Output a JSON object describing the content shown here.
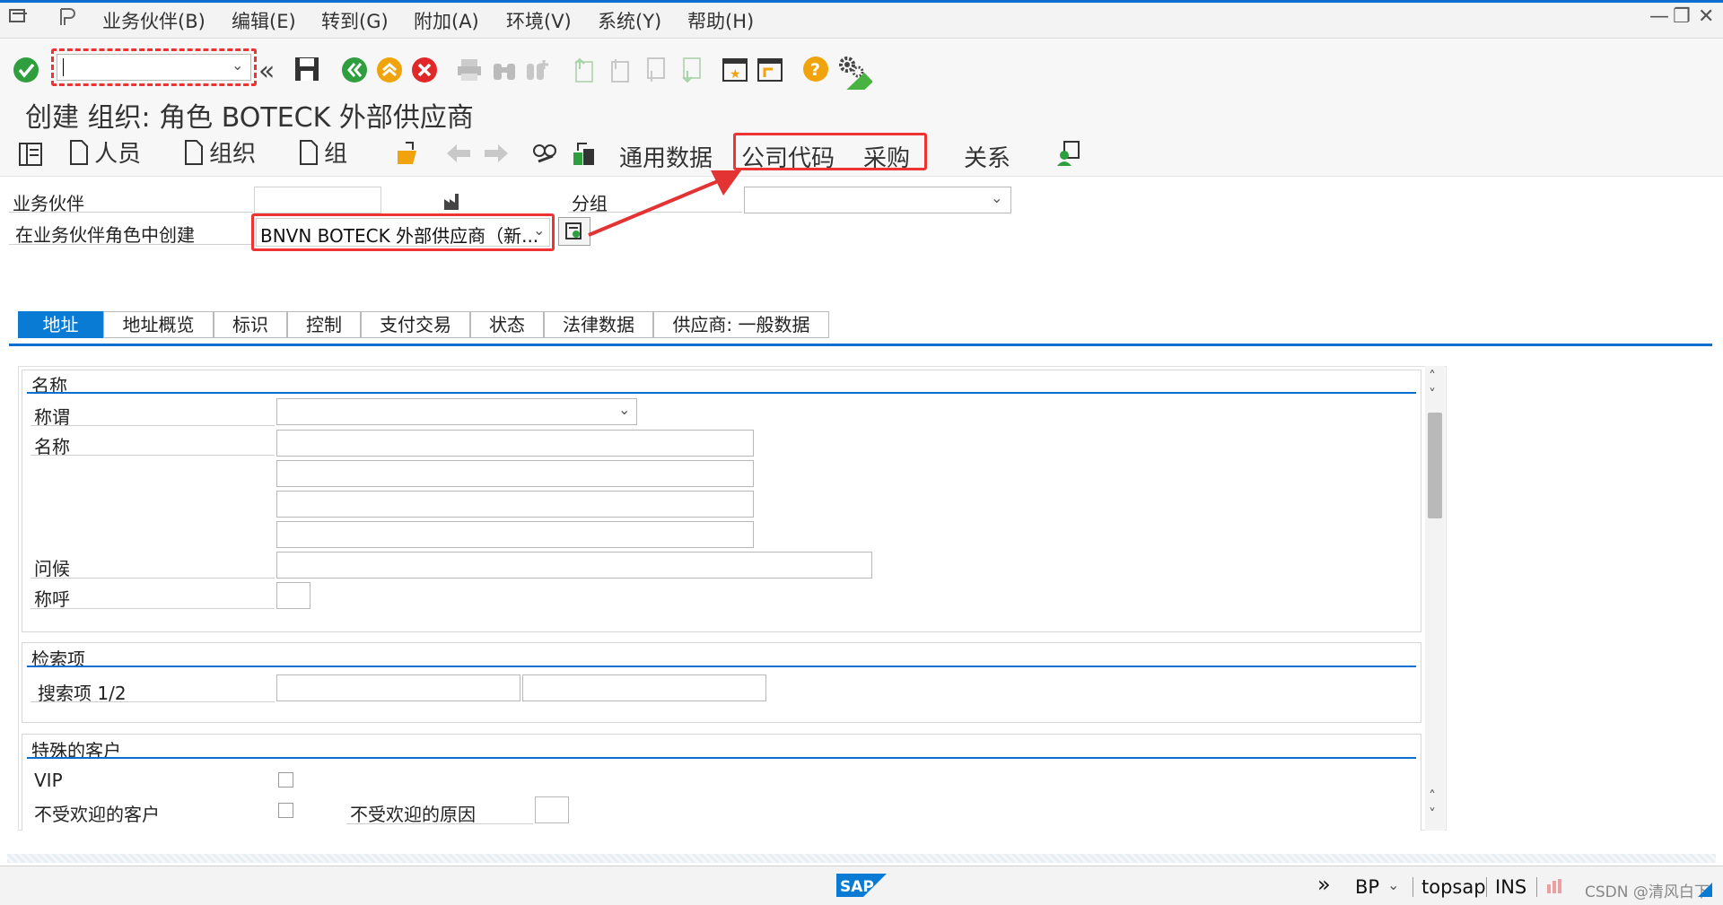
{
  "menu": {
    "items": [
      "业务伙伴(B)",
      "编辑(E)",
      "转到(G)",
      "附加(A)",
      "环境(V)",
      "系统(Y)",
      "帮助(H)"
    ]
  },
  "title": "创建 组织: 角色 BOTECK 外部供应商",
  "app_toolbar": {
    "person": "人员",
    "organization": "组织",
    "group": "组",
    "general_data": "通用数据",
    "company_code": "公司代码",
    "purchasing": "采购",
    "relationships": "关系"
  },
  "header": {
    "bp_label": "业务伙伴",
    "bp_value": "",
    "grouping_label": "分组",
    "grouping_value": "",
    "role_label": "在业务伙伴角色中创建",
    "role_value": "BNVN BOTECK 外部供应商（新..."
  },
  "tabs": [
    {
      "label": "地址",
      "active": true
    },
    {
      "label": "地址概览",
      "active": false
    },
    {
      "label": "标识",
      "active": false
    },
    {
      "label": "控制",
      "active": false
    },
    {
      "label": "支付交易",
      "active": false
    },
    {
      "label": "状态",
      "active": false
    },
    {
      "label": "法律数据",
      "active": false
    },
    {
      "label": "供应商: 一般数据",
      "active": false
    }
  ],
  "name_section": {
    "title": "名称",
    "salutation_label": "称谓",
    "name_label": "名称",
    "greeting_label": "问候",
    "form_of_address_label": "称呼"
  },
  "search_section": {
    "title": "检索项",
    "search_term_label": "搜索项 1/2"
  },
  "special_section": {
    "title": "特殊的客户",
    "vip_label": "VIP",
    "unwanted_label": "不受欢迎的客户",
    "unwanted_reason_label": "不受欢迎的原因"
  },
  "status": {
    "transaction": "BP",
    "system": "topsap",
    "mode": "INS",
    "watermark": "CSDN @清风白下",
    "logo": "SAP"
  },
  "colors": {
    "sap_blue": "#0a6ed1",
    "highlight_red": "#e33333",
    "confirm_green": "#2e9e3e"
  }
}
